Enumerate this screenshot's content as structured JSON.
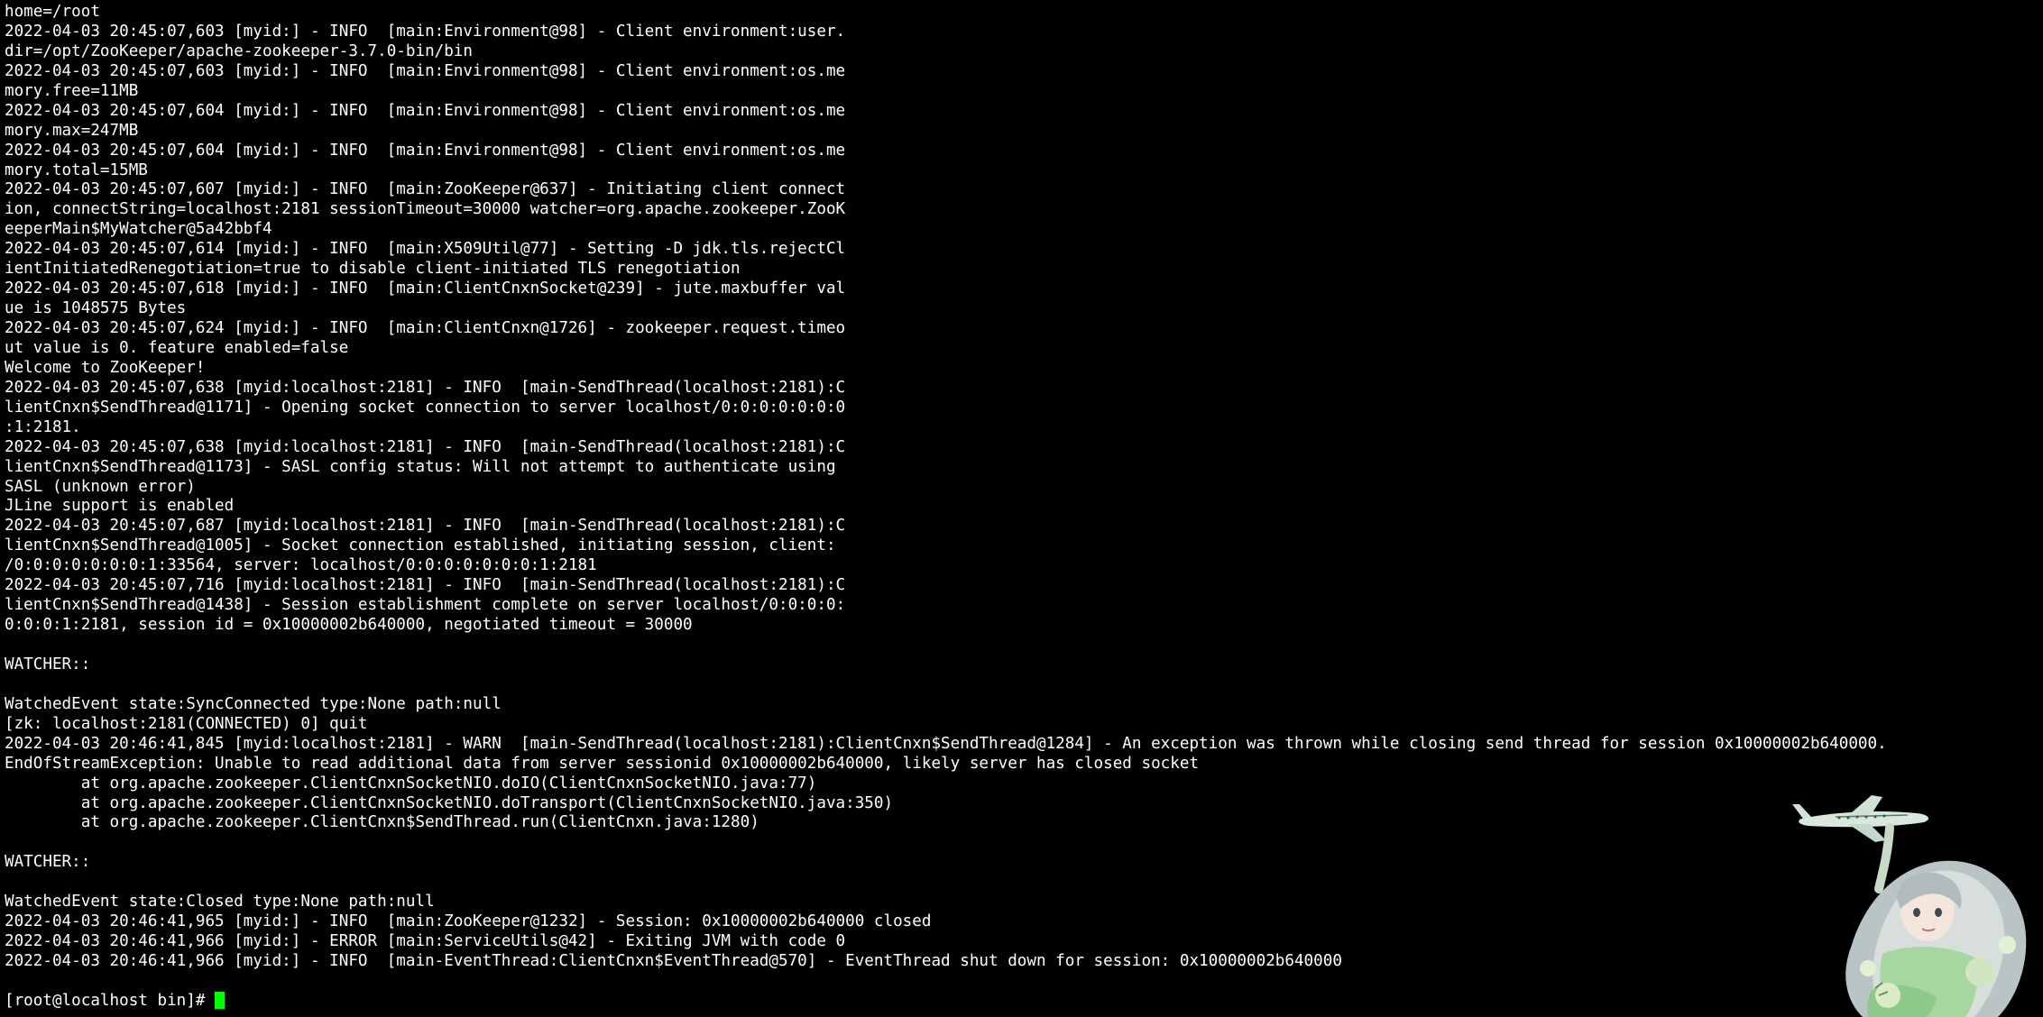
{
  "terminal": {
    "lines": [
      "home=/root",
      "2022-04-03 20:45:07,603 [myid:] - INFO  [main:Environment@98] - Client environment:user.",
      "dir=/opt/ZooKeeper/apache-zookeeper-3.7.0-bin/bin",
      "2022-04-03 20:45:07,603 [myid:] - INFO  [main:Environment@98] - Client environment:os.me",
      "mory.free=11MB",
      "2022-04-03 20:45:07,604 [myid:] - INFO  [main:Environment@98] - Client environment:os.me",
      "mory.max=247MB",
      "2022-04-03 20:45:07,604 [myid:] - INFO  [main:Environment@98] - Client environment:os.me",
      "mory.total=15MB",
      "2022-04-03 20:45:07,607 [myid:] - INFO  [main:ZooKeeper@637] - Initiating client connect",
      "ion, connectString=localhost:2181 sessionTimeout=30000 watcher=org.apache.zookeeper.ZooK",
      "eeperMain$MyWatcher@5a42bbf4",
      "2022-04-03 20:45:07,614 [myid:] - INFO  [main:X509Util@77] - Setting -D jdk.tls.rejectCl",
      "ientInitiatedRenegotiation=true to disable client-initiated TLS renegotiation",
      "2022-04-03 20:45:07,618 [myid:] - INFO  [main:ClientCnxnSocket@239] - jute.maxbuffer val",
      "ue is 1048575 Bytes",
      "2022-04-03 20:45:07,624 [myid:] - INFO  [main:ClientCnxn@1726] - zookeeper.request.timeo",
      "ut value is 0. feature enabled=false",
      "Welcome to ZooKeeper!",
      "2022-04-03 20:45:07,638 [myid:localhost:2181] - INFO  [main-SendThread(localhost:2181):C",
      "lientCnxn$SendThread@1171] - Opening socket connection to server localhost/0:0:0:0:0:0:0",
      ":1:2181.",
      "2022-04-03 20:45:07,638 [myid:localhost:2181] - INFO  [main-SendThread(localhost:2181):C",
      "lientCnxn$SendThread@1173] - SASL config status: Will not attempt to authenticate using",
      "SASL (unknown error)",
      "JLine support is enabled",
      "2022-04-03 20:45:07,687 [myid:localhost:2181] - INFO  [main-SendThread(localhost:2181):C",
      "lientCnxn$SendThread@1005] - Socket connection established, initiating session, client:",
      "/0:0:0:0:0:0:0:1:33564, server: localhost/0:0:0:0:0:0:0:1:2181",
      "2022-04-03 20:45:07,716 [myid:localhost:2181] - INFO  [main-SendThread(localhost:2181):C",
      "lientCnxn$SendThread@1438] - Session establishment complete on server localhost/0:0:0:0:",
      "0:0:0:1:2181, session id = 0x10000002b640000, negotiated timeout = 30000",
      "",
      "WATCHER::",
      "",
      "WatchedEvent state:SyncConnected type:None path:null",
      "[zk: localhost:2181(CONNECTED) 0] quit",
      "2022-04-03 20:46:41,845 [myid:localhost:2181] - WARN  [main-SendThread(localhost:2181):ClientCnxn$SendThread@1284] - An exception was thrown while closing send thread for session 0x10000002b640000.",
      "EndOfStreamException: Unable to read additional data from server sessionid 0x10000002b640000, likely server has closed socket",
      "        at org.apache.zookeeper.ClientCnxnSocketNIO.doIO(ClientCnxnSocketNIO.java:77)",
      "        at org.apache.zookeeper.ClientCnxnSocketNIO.doTransport(ClientCnxnSocketNIO.java:350)",
      "        at org.apache.zookeeper.ClientCnxn$SendThread.run(ClientCnxn.java:1280)",
      "",
      "WATCHER::",
      "",
      "WatchedEvent state:Closed type:None path:null",
      "2022-04-03 20:46:41,965 [myid:] - INFO  [main:ZooKeeper@1232] - Session: 0x10000002b640000 closed",
      "2022-04-03 20:46:41,966 [myid:] - ERROR [main:ServiceUtils@42] - Exiting JVM with code 0",
      "2022-04-03 20:46:41,966 [myid:] - INFO  [main-EventThread:ClientCnxn$EventThread@570] - EventThread shut down for session: 0x10000002b640000"
    ],
    "prompt": "[root@localhost bin]# ",
    "cursor_color": "#00ff00",
    "background_color": "#000000",
    "text_color": "#ffffff"
  }
}
